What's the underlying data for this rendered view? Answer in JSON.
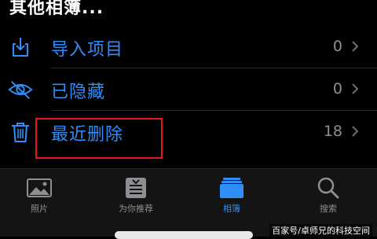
{
  "header": {
    "title": "其他相簿..."
  },
  "rows": [
    {
      "label": "导入项目",
      "count": "0",
      "icon": "import-icon"
    },
    {
      "label": "已隐藏",
      "count": "0",
      "icon": "eye-hidden-icon"
    },
    {
      "label": "最近删除",
      "count": "18",
      "icon": "trash-icon"
    }
  ],
  "tabs": [
    {
      "label": "照片",
      "icon": "photos-icon"
    },
    {
      "label": "为你推荐",
      "icon": "for-you-icon"
    },
    {
      "label": "相簿",
      "icon": "albums-icon",
      "active": true
    },
    {
      "label": "搜索",
      "icon": "search-icon"
    }
  ],
  "watermark": "百家号/卓师兄的科技空间",
  "colors": {
    "accent": "#2f8ef7",
    "highlight": "#e8161c"
  }
}
